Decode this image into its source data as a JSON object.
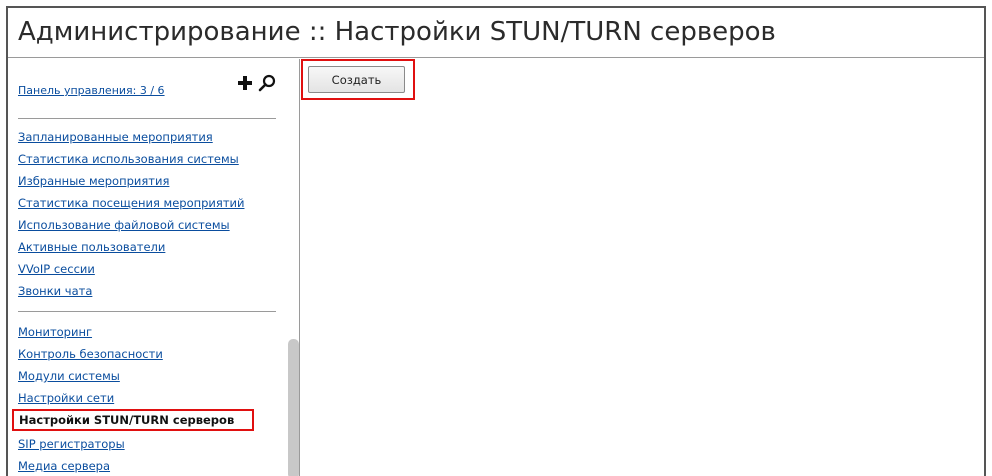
{
  "header": {
    "title": "Администрирование :: Настройки STUN/TURN серверов"
  },
  "sidebar": {
    "panel_link": "Панель управления: 3 / 6",
    "group1": [
      "Запланированные мероприятия",
      "Статистика использования системы",
      "Избранные мероприятия",
      "Статистика посещения мероприятий",
      "Использование файловой системы",
      "Активные пользователи",
      "VVoIP сессии",
      "Звонки чата"
    ],
    "group2": [
      "Мониторинг",
      "Контроль безопасности",
      "Модули системы",
      "Настройки сети",
      "Настройки STUN/TURN серверов",
      "SIP регистраторы",
      "Медиа сервера"
    ],
    "active_item": "Настройки STUN/TURN серверов"
  },
  "main": {
    "create_button_label": "Создать"
  },
  "colors": {
    "link": "#0a4d9e",
    "highlight": "#e01010"
  },
  "icons": [
    "plus-icon",
    "search-icon"
  ]
}
